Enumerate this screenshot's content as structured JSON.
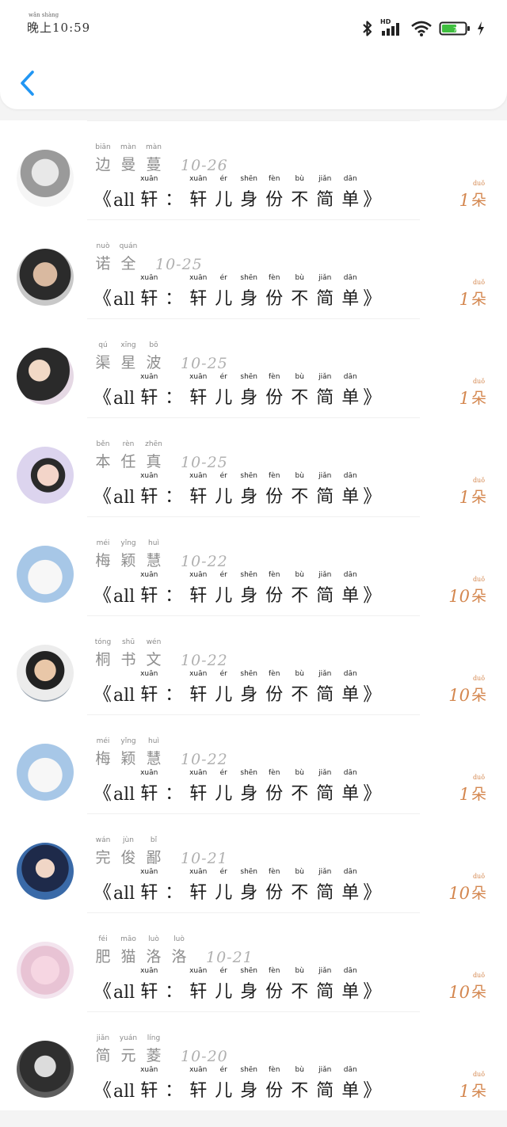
{
  "status_bar": {
    "time_pinyin": "wǎn shàng",
    "time": "晚上10:59",
    "network": "HD",
    "icons": [
      "bluetooth-icon",
      "signal-icon",
      "wifi-icon",
      "battery-icon",
      "charging-icon"
    ]
  },
  "colors": {
    "accent": "#2196f3",
    "count": "#d4874f"
  },
  "list": [
    {
      "name": [
        "边",
        "曼",
        "蔓"
      ],
      "name_py": [
        "biān",
        "màn",
        "màn"
      ],
      "date": "10-26",
      "count": "1"
    },
    {
      "name": [
        "诺",
        "全"
      ],
      "name_py": [
        "nuò",
        "quán"
      ],
      "date": "10-25",
      "count": "1"
    },
    {
      "name": [
        "渠",
        "星",
        "波"
      ],
      "name_py": [
        "qú",
        "xīng",
        "bō"
      ],
      "date": "10-25",
      "count": "1"
    },
    {
      "name": [
        "本",
        "任",
        "真"
      ],
      "name_py": [
        "běn",
        "rèn",
        "zhēn"
      ],
      "date": "10-25",
      "count": "1"
    },
    {
      "name": [
        "梅",
        "颖",
        "慧"
      ],
      "name_py": [
        "méi",
        "yǐng",
        "huì"
      ],
      "date": "10-22",
      "count": "10"
    },
    {
      "name": [
        "桐",
        "书",
        "文"
      ],
      "name_py": [
        "tóng",
        "shū",
        "wén"
      ],
      "date": "10-22",
      "count": "10"
    },
    {
      "name": [
        "梅",
        "颖",
        "慧"
      ],
      "name_py": [
        "méi",
        "yǐng",
        "huì"
      ],
      "date": "10-22",
      "count": "1"
    },
    {
      "name": [
        "完",
        "俊",
        "鄙"
      ],
      "name_py": [
        "wán",
        "jùn",
        "bǐ"
      ],
      "date": "10-21",
      "count": "10"
    },
    {
      "name": [
        "肥",
        "猫",
        "洛",
        "洛"
      ],
      "name_py": [
        "féi",
        "māo",
        "luò",
        "luò"
      ],
      "date": "10-21",
      "count": "10"
    },
    {
      "name": [
        "简",
        "元",
        "菱"
      ],
      "name_py": [
        "jiǎn",
        "yuán",
        "líng"
      ],
      "date": "10-20",
      "count": "1"
    }
  ],
  "title": {
    "open": "《",
    "prefix": "all",
    "first_char": "轩",
    "first_py": "xuān",
    "colon": "：",
    "chars": [
      "轩",
      "儿",
      "身",
      "份",
      "不",
      "简",
      "单"
    ],
    "pinyin": [
      "xuān",
      "ér",
      "shēn",
      "fèn",
      "bù",
      "jiǎn",
      "dān"
    ],
    "close": "》"
  },
  "unit": {
    "char": "朵",
    "py": "duǒ"
  }
}
